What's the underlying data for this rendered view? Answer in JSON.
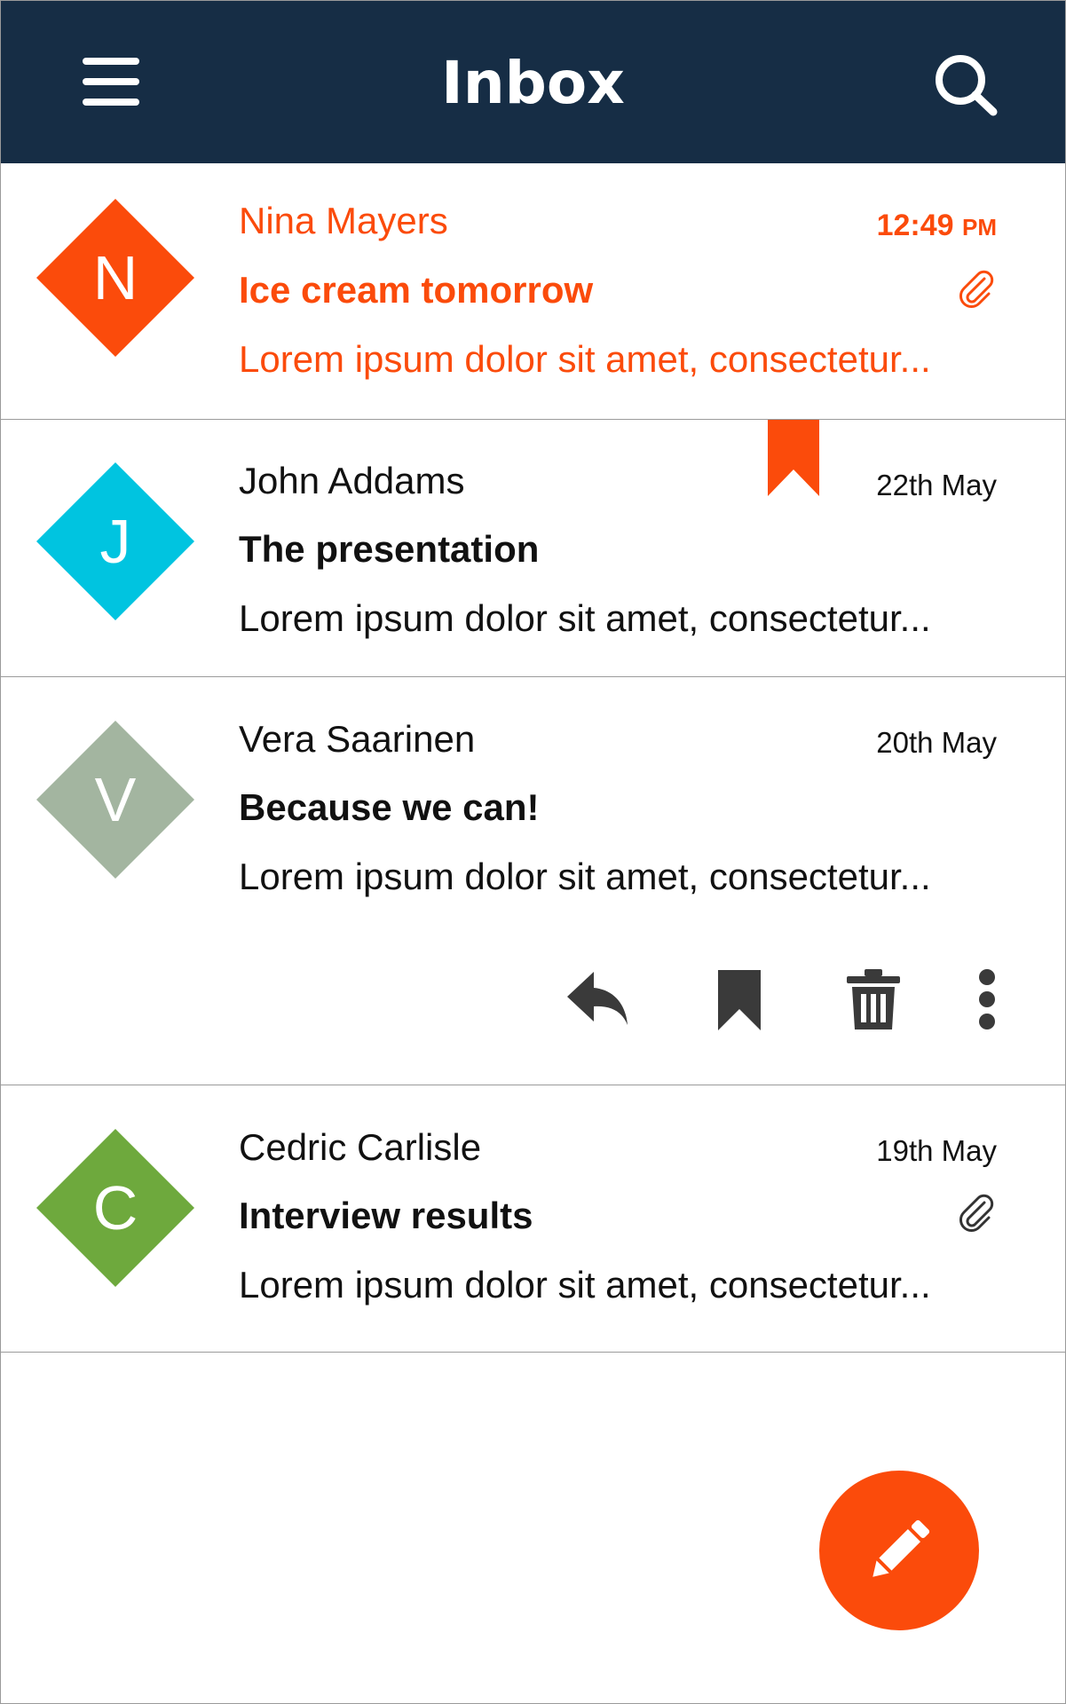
{
  "header": {
    "title": "Inbox",
    "menu_icon": "hamburger-menu-icon",
    "search_icon": "search-icon",
    "background_color": "#162d45"
  },
  "accent_color": "#fb4b0b",
  "emails": [
    {
      "avatar_letter": "N",
      "avatar_color": "#fb4b0b",
      "sender": "Nina Mayers",
      "subject": "Ice cream tomorrow",
      "preview": "Lorem ipsum dolor sit amet, consectetur...",
      "time": "12:49",
      "time_suffix": "PM",
      "unread": true,
      "has_attachment": true,
      "bookmarked": false
    },
    {
      "avatar_letter": "J",
      "avatar_color": "#00c4e0",
      "sender": "John Addams",
      "subject": "The presentation",
      "preview": "Lorem ipsum dolor sit amet, consectetur...",
      "time": "22th May",
      "unread": false,
      "has_attachment": false,
      "bookmarked": true
    },
    {
      "avatar_letter": "V",
      "avatar_color": "#a3b5a0",
      "sender": "Vera Saarinen",
      "subject": "Because we can!",
      "preview": "Lorem ipsum dolor sit amet, consectetur...",
      "time": "20th May",
      "unread": false,
      "has_attachment": false,
      "bookmarked": false,
      "actions": [
        "reply-icon",
        "bookmark-icon",
        "trash-icon",
        "more-vertical-icon"
      ]
    },
    {
      "avatar_letter": "C",
      "avatar_color": "#6ea93d",
      "sender": "Cedric Carlisle",
      "subject": "Interview results",
      "preview": "Lorem ipsum dolor sit amet, consectetur...",
      "time": "19th May",
      "unread": false,
      "has_attachment": true,
      "bookmarked": false
    }
  ],
  "fab": {
    "icon": "pencil-icon",
    "color": "#fb4b0b"
  }
}
